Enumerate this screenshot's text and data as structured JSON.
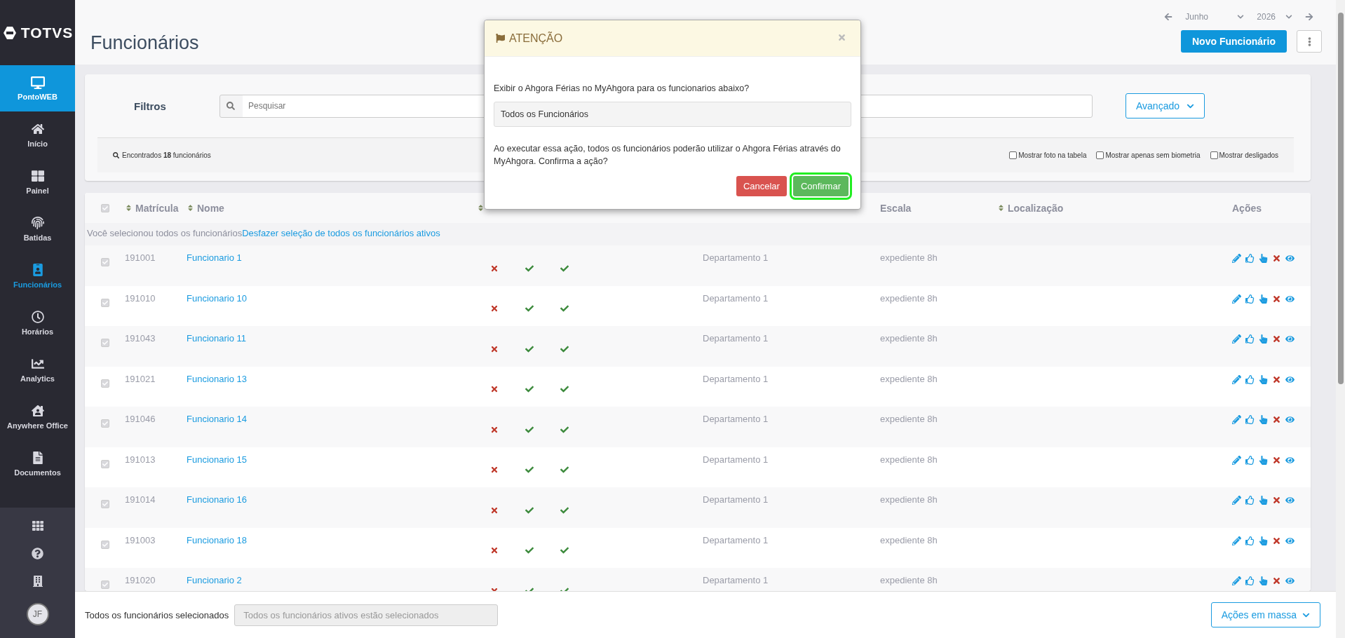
{
  "sidebar": {
    "logo": "TOTVS",
    "product": {
      "label": "PontoWEB"
    },
    "items": [
      {
        "label": "Início",
        "selected": false
      },
      {
        "label": "Painel",
        "selected": false
      },
      {
        "label": "Batidas",
        "selected": false
      },
      {
        "label": "Funcionários",
        "selected": true
      },
      {
        "label": "Horários",
        "selected": false
      },
      {
        "label": "Analytics",
        "selected": false
      },
      {
        "label": "Anywhere Office",
        "selected": false
      },
      {
        "label": "Documentos",
        "selected": false
      }
    ],
    "avatar": "JF"
  },
  "header": {
    "title": "Funcionários",
    "month": "Junho",
    "year": "2026",
    "primary_button": "Novo Funcionário"
  },
  "filters": {
    "label": "Filtros",
    "search": {
      "placeholder": "Pesquisar"
    },
    "advanced_button": "Avançado",
    "found": "Encontrados **18** funcionários",
    "options": [
      {
        "label": "Mostrar foto na tabela",
        "checked": false
      },
      {
        "label": "Mostrar apenas sem biometria",
        "checked": false
      },
      {
        "label": "Mostrar desligados",
        "checked": false
      }
    ]
  },
  "table": {
    "all_checked": true,
    "columns": [
      {
        "label": "Matrícula",
        "sortable": true
      },
      {
        "label": "Nome",
        "sortable": true
      },
      {
        "sortable": true
      },
      {
        "label": "Escala",
        "sortable": false
      },
      {
        "label": "Localização",
        "sortable": true
      },
      {
        "label": "Ações",
        "sortable": false
      }
    ],
    "selection_message": {
      "text": "Você selecionou todos os funcionários",
      "link": "Desfazer seleção de todos os funcionários ativos"
    },
    "rows": [
      {
        "checked": true,
        "matricula": "191001",
        "nome": "Funcionario 1",
        "status": [
          false,
          true,
          true
        ],
        "departamento": "Departamento 1",
        "escala": "expediente 8h"
      },
      {
        "checked": true,
        "matricula": "191010",
        "nome": "Funcionario 10",
        "status": [
          false,
          true,
          true
        ],
        "departamento": "Departamento 1",
        "escala": "expediente 8h"
      },
      {
        "checked": true,
        "matricula": "191043",
        "nome": "Funcionario 11",
        "status": [
          false,
          true,
          true
        ],
        "departamento": "Departamento 1",
        "escala": "expediente 8h"
      },
      {
        "checked": true,
        "matricula": "191021",
        "nome": "Funcionario 13",
        "status": [
          false,
          true,
          true
        ],
        "departamento": "Departamento 1",
        "escala": "expediente 8h"
      },
      {
        "checked": true,
        "matricula": "191046",
        "nome": "Funcionario 14",
        "status": [
          false,
          true,
          true
        ],
        "departamento": "Departamento 1",
        "escala": "expediente 8h"
      },
      {
        "checked": true,
        "matricula": "191013",
        "nome": "Funcionario 15",
        "status": [
          false,
          true,
          true
        ],
        "departamento": "Departamento 1",
        "escala": "expediente 8h"
      },
      {
        "checked": true,
        "matricula": "191014",
        "nome": "Funcionario 16",
        "status": [
          false,
          true,
          true
        ],
        "departamento": "Departamento 1",
        "escala": "expediente 8h"
      },
      {
        "checked": true,
        "matricula": "191003",
        "nome": "Funcionario 18",
        "status": [
          false,
          true,
          true
        ],
        "departamento": "Departamento 1",
        "escala": "expediente 8h"
      },
      {
        "checked": true,
        "matricula": "191020",
        "nome": "Funcionario 2",
        "status": [
          false,
          true,
          true
        ],
        "departamento": "Departamento 1",
        "escala": "expediente 8h"
      }
    ]
  },
  "bottom_bar": {
    "label": "Todos os funcionários selecionados",
    "field_value": "Todos os funcionários ativos estão selecionados",
    "mass_button": "Ações em massa"
  },
  "modal": {
    "title": "ATENÇÃO",
    "question": "Exibir o Ahgora Férias no MyAhgora para os funcionarios abaixo?",
    "field_value": "Todos os Funcionários",
    "message": "Ao executar essa ação, todos os funcionários poderão utilizar o Ahgora Férias através do MyAhgora. Confirma a ação?",
    "cancel": "Cancelar",
    "confirm": "Confirmar",
    "confirm_highlighted": true
  }
}
